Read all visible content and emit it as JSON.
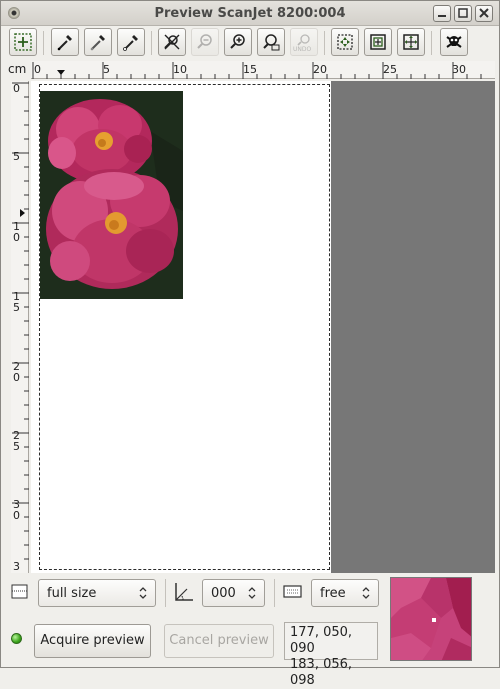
{
  "window": {
    "title": "Preview ScanJet 8200:004"
  },
  "ruler": {
    "unit": "cm",
    "h_ticks": [
      "0",
      "5",
      "10",
      "15",
      "20",
      "25",
      "30"
    ],
    "v_ticks": [
      "0",
      "5",
      "1\n0",
      "1\n5",
      "2\n0",
      "2\n5",
      "3\n0",
      "3"
    ]
  },
  "toolbar": {
    "undo_label": "UNDO"
  },
  "controls": {
    "preview_size": "full size",
    "rotation": "000",
    "aspect": "free",
    "acquire_label": "Acquire preview",
    "cancel_label": "Cancel preview",
    "rgb_line1": "177, 050, 090",
    "rgb_line2": "183, 056, 098"
  },
  "colors": {
    "preview_background": "#777777",
    "paper": "#ffffff",
    "led": "#3aa31a"
  }
}
